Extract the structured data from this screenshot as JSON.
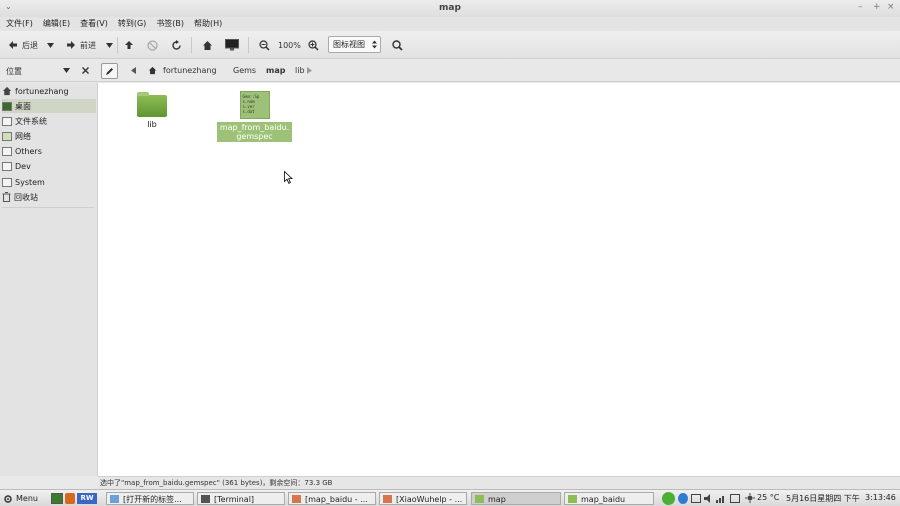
{
  "window": {
    "title": "map",
    "menu_arrow": "⌄",
    "controls": {
      "minimize": "–",
      "maximize": "+",
      "close": "×"
    }
  },
  "menubar": [
    "文件(F)",
    "编辑(E)",
    "查看(V)",
    "转到(G)",
    "书签(B)",
    "帮助(H)"
  ],
  "toolbar": {
    "back_label": "后退",
    "forward_label": "前进",
    "zoom_level": "100%",
    "view_mode": "图标视图"
  },
  "locationbar": {
    "places_label": "位置",
    "breadcrumbs": [
      "fortunezhang",
      "Gems",
      "map",
      "lib"
    ],
    "current_index": 2
  },
  "sidebar": {
    "items": [
      {
        "label": "fortunezhang",
        "icon": "home-icon"
      },
      {
        "label": "桌面",
        "icon": "desktop-icon",
        "selected": true
      },
      {
        "label": "文件系统",
        "icon": "drive-icon"
      },
      {
        "label": "网络",
        "icon": "network-icon"
      },
      {
        "label": "Others",
        "icon": "drive-icon"
      },
      {
        "label": "Dev",
        "icon": "drive-icon"
      },
      {
        "label": "System",
        "icon": "drive-icon"
      },
      {
        "label": "回收站",
        "icon": "trash-icon"
      }
    ]
  },
  "files": [
    {
      "name": "lib",
      "type": "folder",
      "selected": false
    },
    {
      "name": "map_from_baidu.gemspec",
      "name_lines": [
        "map_from_baidu.",
        "gemspec"
      ],
      "type": "file",
      "preview": [
        "Gem::Sp",
        "s.nam",
        "s.ver",
        "s.dat"
      ],
      "selected": true
    }
  ],
  "statusbar": {
    "text": "选中了\"map_from_baidu.gemspec\" (361 bytes)，剩余空间：73.3 GB"
  },
  "taskbar": {
    "menu_label": "Menu",
    "tasks": [
      {
        "label": "[打开新的标签...",
        "active": false
      },
      {
        "label": "[Terminal]",
        "active": false
      },
      {
        "label": "[map_baidu - ...",
        "active": false
      },
      {
        "label": "[XiaoWuhelp - ...",
        "active": false
      },
      {
        "label": "map",
        "active": true
      },
      {
        "label": "map_baidu",
        "active": false
      }
    ],
    "weather": "25 °C",
    "date": "5月16日星期四 下午",
    "time": "3:13:46"
  },
  "colors": {
    "accent_green": "#9dc277",
    "folder_green": "#6fa23c"
  }
}
